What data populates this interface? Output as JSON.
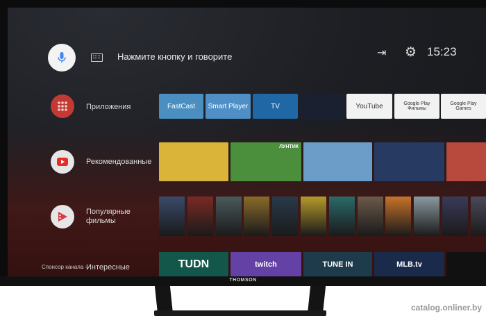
{
  "top_bar": {
    "voice_hint": "Нажмите кнопку и говорите",
    "time": "15:23"
  },
  "rows": {
    "apps": {
      "label": "Приложения"
    },
    "recommended": {
      "label": "Рекомендованные"
    },
    "popular": {
      "label": "Популярные фильмы"
    },
    "channel": {
      "label": "Интересные",
      "sponsor": "Спонсор канала -"
    }
  },
  "apps": [
    {
      "name": "FastCast",
      "color": "#4a8fbf"
    },
    {
      "name": "Smart Player",
      "color": "#4f8fc6"
    },
    {
      "name": "TV",
      "color": "#1f67a5"
    },
    {
      "name": "",
      "color": "#1b2030"
    },
    {
      "name": "YouTube",
      "color": "#f2f2f2"
    },
    {
      "name": "Google Play Фильмы",
      "color": "#f2f2f2"
    },
    {
      "name": "Google Play Games",
      "color": "#f2f2f2"
    }
  ],
  "recommended_tiles": [
    {
      "color": "#d9b438",
      "logo": ""
    },
    {
      "color": "#4b8f3c",
      "logo": "ЛУНТИК"
    },
    {
      "color": "#6c9cc8",
      "logo": ""
    },
    {
      "color": "#263a62",
      "logo": ""
    },
    {
      "color": "#b74a3c",
      "logo": ""
    }
  ],
  "movie_posters": [
    "#3a4a6a",
    "#7a2a24",
    "#4a5a5a",
    "#8a6a2a",
    "#2a3a4a",
    "#b59a2a",
    "#2a6a6a",
    "#6a5a4a",
    "#c7732a",
    "#8a9aa0",
    "#3a3a5a",
    "#4a4a5a"
  ],
  "channel_tiles": [
    {
      "logo": "TUDN",
      "color": "#12574a"
    },
    {
      "logo": "twitch",
      "color": "#6441a4"
    },
    {
      "logo": "TUNE IN",
      "color": "#1d3b4b"
    },
    {
      "logo": "MLB.tv",
      "color": "#1a2a4a"
    },
    {
      "logo": "",
      "color": "#111111"
    }
  ],
  "tv_brand": "THOMSON",
  "watermark": "catalog.onliner.by"
}
